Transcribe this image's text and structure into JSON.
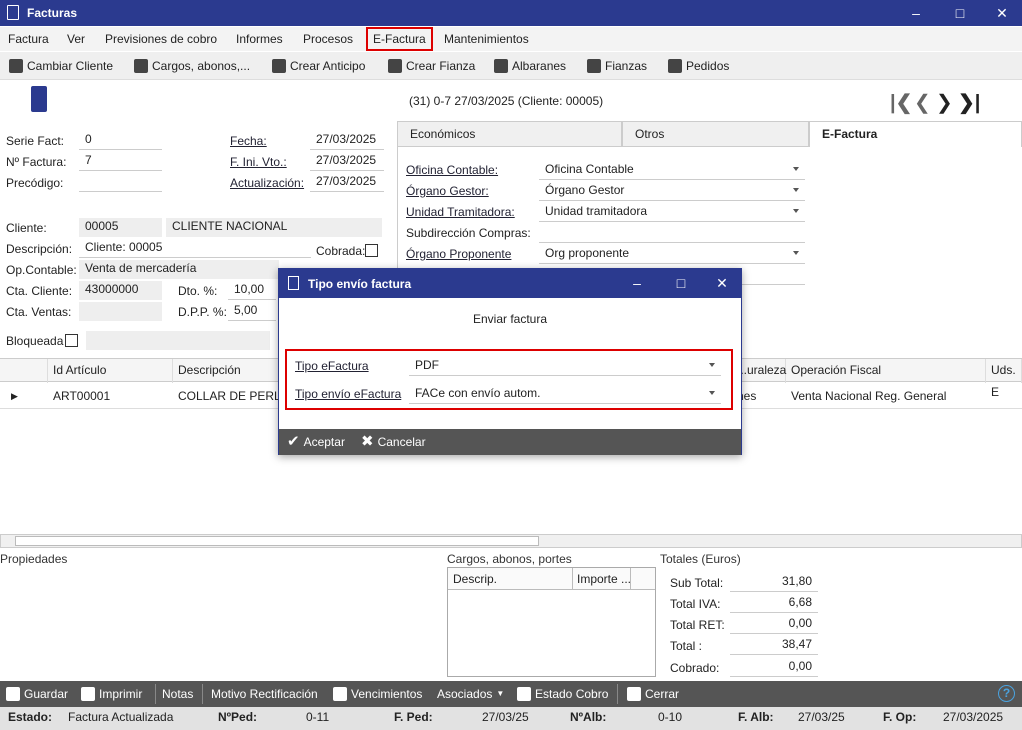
{
  "window": {
    "title": "Facturas"
  },
  "menu": [
    "Factura",
    "Ver",
    "Previsiones de cobro",
    "Informes",
    "Procesos",
    "E-Factura",
    "Mantenimientos"
  ],
  "toolbar": [
    "Cambiar Cliente",
    "Cargos, abonos,...",
    "Crear Anticipo",
    "Crear Fianza",
    "Albaranes",
    "Fianzas",
    "Pedidos"
  ],
  "record_info": "(31) 0-7  27/03/2025  (Cliente: 00005)",
  "form": {
    "serie_label": "Serie Fact:",
    "serie": "0",
    "num_label": "Nº Factura:",
    "num": "7",
    "precodigo_label": "Precódigo:",
    "precodigo": "",
    "fecha_label": "Fecha:",
    "fecha": "27/03/2025",
    "fini_label": "F. Ini. Vto.:",
    "fini": "27/03/2025",
    "actual_label": "Actualización:",
    "actual": "27/03/2025",
    "cliente_label": "Cliente:",
    "cliente_code": "00005",
    "cliente_name": "CLIENTE NACIONAL",
    "desc_label": "Descripción:",
    "desc": "Cliente: 00005",
    "cobrada_label": "Cobrada:",
    "opcont_label": "Op.Contable:",
    "opcont": "Venta de mercadería",
    "ctacli_label": "Cta. Cliente:",
    "ctacli": "43000000",
    "dto_label": "Dto. %:",
    "dto": "10,00",
    "ctaven_label": "Cta. Ventas:",
    "ctaven": "",
    "dpp_label": "D.P.P. %:",
    "dpp": "5,00",
    "bloq_label": "Bloqueada"
  },
  "tabs": [
    "Económicos",
    "Otros",
    "E-Factura"
  ],
  "efactura": {
    "oficina_label": "Oficina Contable:",
    "oficina": "Oficina Contable",
    "organo_label": "Órgano Gestor:",
    "organo": "Órgano Gestor",
    "unidad_label": "Unidad Tramitadora:",
    "unidad": "Unidad tramitadora",
    "subdir_label": "Subdirección Compras:",
    "subdir": "",
    "proponente_label": "Órgano Proponente",
    "proponente": "Org proponente"
  },
  "grid": {
    "headers": [
      "Id Artículo",
      "Descripción",
      "...uraleza",
      "Operación Fiscal",
      "Uds. E"
    ],
    "row": {
      "id": "ART00001",
      "desc": "COLLAR DE PERLAS",
      "nat": "nes",
      "op": "Venta Nacional Reg. General"
    }
  },
  "props_label": "Propiedades",
  "cargos": {
    "title": "Cargos, abonos, portes",
    "col1": "Descrip.",
    "col2": "Importe ..."
  },
  "totales": {
    "title": "Totales (Euros)",
    "subtotal_label": "Sub Total:",
    "subtotal": "31,80",
    "iva_label": "Total IVA:",
    "iva": "6,68",
    "ret_label": "Total RET:",
    "ret": "0,00",
    "total_label": "Total :",
    "total": "38,47",
    "cobrado_label": "Cobrado:",
    "cobrado": "0,00"
  },
  "bottom": [
    "Guardar",
    "Imprimir",
    "Notas",
    "Motivo Rectificación",
    "Vencimientos",
    "Asociados",
    "Estado Cobro",
    "Cerrar"
  ],
  "status": {
    "estado_l": "Estado:",
    "estado": "Factura Actualizada",
    "nped_l": "NºPed:",
    "nped": "0-11",
    "fped_l": "F. Ped:",
    "fped": "27/03/25",
    "nalb_l": "NºAlb:",
    "nalb": "0-10",
    "falb_l": "F. Alb:",
    "falb": "27/03/25",
    "fop_l": "F. Op:",
    "fop": "27/03/2025"
  },
  "modal": {
    "title": "Tipo envío factura",
    "heading": "Enviar factura",
    "tipo_label": "Tipo eFactura",
    "tipo": "PDF",
    "envio_label": "Tipo envío eFactura",
    "envio": "FACe con envío autom.",
    "accept": "Aceptar",
    "cancel": "Cancelar"
  }
}
